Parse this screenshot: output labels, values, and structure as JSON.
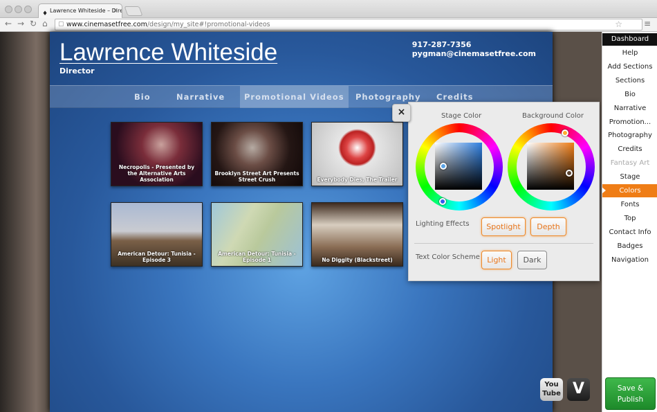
{
  "browser": {
    "tab_title": "Lawrence Whiteside – Dire",
    "tab_icon": "flame-icon",
    "url_host": "www.cinemasetfree.com",
    "url_path": "/design/my_site#!promotional-videos"
  },
  "site": {
    "name": "Lawrence Whiteside",
    "role": "Director",
    "phone": "917-287-7356",
    "email": "pygman@cinemasetfree.com",
    "nav": [
      "Bio",
      "Narrative",
      "Promotional Videos",
      "Photography",
      "Credits"
    ],
    "active_nav": "Promotional Videos",
    "videos": [
      {
        "caption": "Necropolis - Presented by the Alternative Arts Association"
      },
      {
        "caption": "Brooklyn Street Art Presents Street Crush"
      },
      {
        "caption": "Everybody Dies, The Trailer"
      },
      {
        "caption": "American Detour: Tunisia - Episode 3"
      },
      {
        "caption": "American Detour: Tunisia - Episode 1"
      },
      {
        "caption": "No Diggity (Blackstreet)"
      }
    ],
    "social": [
      {
        "name": "youtube-icon",
        "label": "You Tube"
      },
      {
        "name": "vimeo-icon",
        "label": "V"
      }
    ],
    "stage_color": "#2d64aa"
  },
  "color_panel": {
    "close_label": "×",
    "stage_color_label": "Stage Color",
    "background_color_label": "Background Color",
    "lighting_label": "Lighting Effects",
    "lighting_options": [
      "Spotlight",
      "Depth"
    ],
    "text_scheme_label": "Text Color Scheme",
    "text_scheme_options": [
      "Light",
      "Dark"
    ],
    "text_scheme_selected": "Light",
    "accent_color": "#ef7d16"
  },
  "sidebar": {
    "header": "Dashboard",
    "items": [
      {
        "label": "Help",
        "state": "normal"
      },
      {
        "label": "Add Sections",
        "state": "normal"
      },
      {
        "label": "Sections",
        "state": "normal"
      },
      {
        "label": "Bio",
        "state": "normal"
      },
      {
        "label": "Narrative",
        "state": "normal"
      },
      {
        "label": "Promotion...",
        "state": "normal"
      },
      {
        "label": "Photography",
        "state": "normal"
      },
      {
        "label": "Credits",
        "state": "normal"
      },
      {
        "label": "Fantasy Art",
        "state": "disabled"
      },
      {
        "label": "Stage",
        "state": "normal"
      },
      {
        "label": "Colors",
        "state": "active"
      },
      {
        "label": "Fonts",
        "state": "normal"
      },
      {
        "label": "Top",
        "state": "normal"
      },
      {
        "label": "Contact Info",
        "state": "normal"
      },
      {
        "label": "Badges",
        "state": "normal"
      },
      {
        "label": "Navigation",
        "state": "normal"
      }
    ],
    "publish_line1": "Save &",
    "publish_line2": "Publish"
  }
}
